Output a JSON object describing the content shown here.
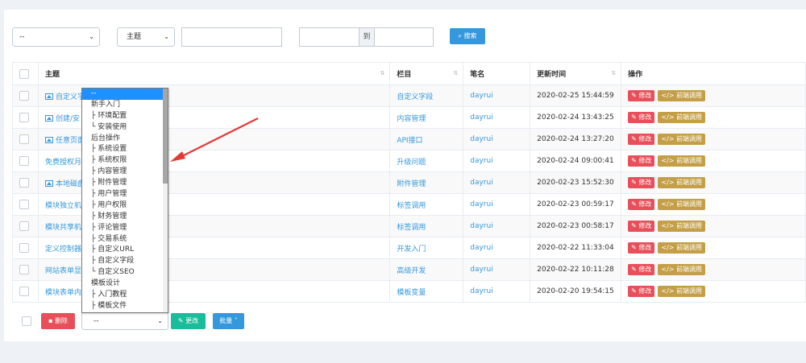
{
  "filters": {
    "column_select": "--",
    "field_select": "主题",
    "date_separator": "到",
    "search_label": "搜索"
  },
  "table": {
    "headers": [
      "主题",
      "栏目",
      "笔名",
      "更新时间",
      "操作"
    ],
    "rows": [
      {
        "title": "自定义字",
        "has_image": true,
        "category": "自定义字段",
        "author": "dayrui",
        "time": "2020-02-25 15:44:59"
      },
      {
        "title": "创建/安",
        "has_image": true,
        "category": "内容管理",
        "author": "dayrui",
        "time": "2020-02-24 13:43:25"
      },
      {
        "title": "任意页面",
        "has_image": true,
        "category": "API接口",
        "author": "dayrui",
        "time": "2020-02-24 13:27:20"
      },
      {
        "title": "免费授权月",
        "has_image": false,
        "category": "升级问题",
        "author": "dayrui",
        "time": "2020-02-24 09:00:41"
      },
      {
        "title": "本地磁盘",
        "has_image": true,
        "category": "附件管理",
        "author": "dayrui",
        "time": "2020-02-23 15:52:30"
      },
      {
        "title": "模块独立机",
        "has_image": false,
        "category": "标签调用",
        "author": "dayrui",
        "time": "2020-02-23 00:59:17"
      },
      {
        "title": "模块共享机",
        "has_image": false,
        "category": "标签调用",
        "author": "dayrui",
        "time": "2020-02-23 00:58:17"
      },
      {
        "title": "定义控制器",
        "has_image": false,
        "category": "开发入门",
        "author": "dayrui",
        "time": "2020-02-22 11:33:04"
      },
      {
        "title": "网站表单显",
        "has_image": false,
        "category": "高级开发",
        "author": "dayrui",
        "time": "2020-02-22 10:11:28"
      },
      {
        "title": "模块表单内",
        "has_image": false,
        "category": "模板变量",
        "author": "dayrui",
        "time": "2020-02-20 19:54:15"
      }
    ],
    "edit_label": "修改",
    "call_label": "前端调用"
  },
  "dropdown": {
    "options": [
      "--",
      "新手入门",
      "├ 环境配置",
      "└ 安装使用",
      "后台操作",
      "├ 系统设置",
      "├ 系统权限",
      "├ 内容管理",
      "├ 附件管理",
      "├ 用户管理",
      "├ 用户权限",
      "├ 财务管理",
      "├ 评论管理",
      "├ 交易系统",
      "├ 自定义URL",
      "├ 自定义字段",
      "└ 自定义SEO",
      "模板设计",
      "├ 入门教程",
      "├ 模板文件"
    ],
    "selected_index": 0
  },
  "footer": {
    "delete_label": "删除",
    "move_select": "--",
    "change_label": "更改",
    "batch_label": "批量"
  },
  "colors": {
    "primary": "#3598dc",
    "danger": "#e7505a",
    "gold": "#c49f47",
    "success": "#1bbc9b",
    "annotation_arrow": "#e53935"
  }
}
